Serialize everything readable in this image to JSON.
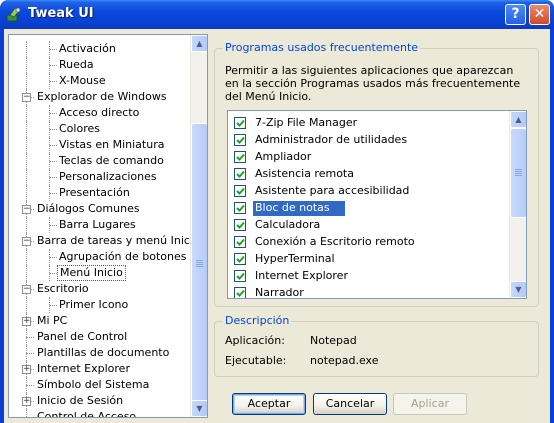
{
  "window": {
    "title": "Tweak UI",
    "help_glyph": "?",
    "close_glyph": "✕"
  },
  "tree": {
    "items": [
      {
        "label": "Activación",
        "level": 2,
        "expander": null
      },
      {
        "label": "Rueda",
        "level": 2,
        "expander": null
      },
      {
        "label": "X-Mouse",
        "level": 2,
        "expander": null
      },
      {
        "label": "Explorador de Windows",
        "level": 1,
        "expander": "minus"
      },
      {
        "label": "Acceso directo",
        "level": 2,
        "expander": null
      },
      {
        "label": "Colores",
        "level": 2,
        "expander": null
      },
      {
        "label": "Vistas en Miniatura",
        "level": 2,
        "expander": null
      },
      {
        "label": "Teclas de comando",
        "level": 2,
        "expander": null
      },
      {
        "label": "Personalizaciones",
        "level": 2,
        "expander": null
      },
      {
        "label": "Presentación",
        "level": 2,
        "expander": null
      },
      {
        "label": "Diálogos Comunes",
        "level": 1,
        "expander": "minus"
      },
      {
        "label": "Barra Lugares",
        "level": 2,
        "expander": null
      },
      {
        "label": "Barra de tareas y menú Inicio",
        "level": 1,
        "expander": "minus"
      },
      {
        "label": "Agrupación de botones",
        "level": 2,
        "expander": null
      },
      {
        "label": "Menú Inicio",
        "level": 2,
        "expander": null,
        "selected": true
      },
      {
        "label": "Escritorio",
        "level": 1,
        "expander": "minus"
      },
      {
        "label": "Primer Icono",
        "level": 2,
        "expander": null
      },
      {
        "label": "Mi PC",
        "level": 1,
        "expander": "plus"
      },
      {
        "label": "Panel de Control",
        "level": 1,
        "expander": null
      },
      {
        "label": "Plantillas de documento",
        "level": 1,
        "expander": null
      },
      {
        "label": "Internet Explorer",
        "level": 1,
        "expander": "plus"
      },
      {
        "label": "Símbolo del Sistema",
        "level": 1,
        "expander": null
      },
      {
        "label": "Inicio de Sesión",
        "level": 1,
        "expander": "plus"
      },
      {
        "label": "Control de Acceso",
        "level": 1,
        "expander": null
      }
    ]
  },
  "programs_group": {
    "title": "Programas usados frecuentemente",
    "description": "Permitir a las siguientes aplicaciones que aparezcan en la sección Programas usados más frecuentemente del Menú Inicio.",
    "items": [
      {
        "label": "7-Zip File Manager",
        "checked": true
      },
      {
        "label": "Administrador de utilidades",
        "checked": true
      },
      {
        "label": "Ampliador",
        "checked": true
      },
      {
        "label": "Asistencia remota",
        "checked": true
      },
      {
        "label": "Asistente para accesibilidad",
        "checked": true
      },
      {
        "label": "Bloc de notas",
        "checked": true,
        "selected": true
      },
      {
        "label": "Calculadora",
        "checked": true
      },
      {
        "label": "Conexión a Escritorio remoto",
        "checked": true
      },
      {
        "label": "HyperTerminal",
        "checked": true
      },
      {
        "label": "Internet Explorer",
        "checked": true
      },
      {
        "label": "Narrador",
        "checked": true
      }
    ]
  },
  "description_group": {
    "title": "Descripción",
    "app_label": "Aplicación:",
    "app_value": "Notepad",
    "exe_label": "Ejecutable:",
    "exe_value": "notepad.exe"
  },
  "buttons": {
    "accept": "Aceptar",
    "cancel": "Cancelar",
    "apply": "Aplicar"
  },
  "colors": {
    "titlebar": "#0A48DB",
    "selection": "#316AC5",
    "group_title": "#0046D5",
    "dialog_bg": "#ECE9D8"
  }
}
